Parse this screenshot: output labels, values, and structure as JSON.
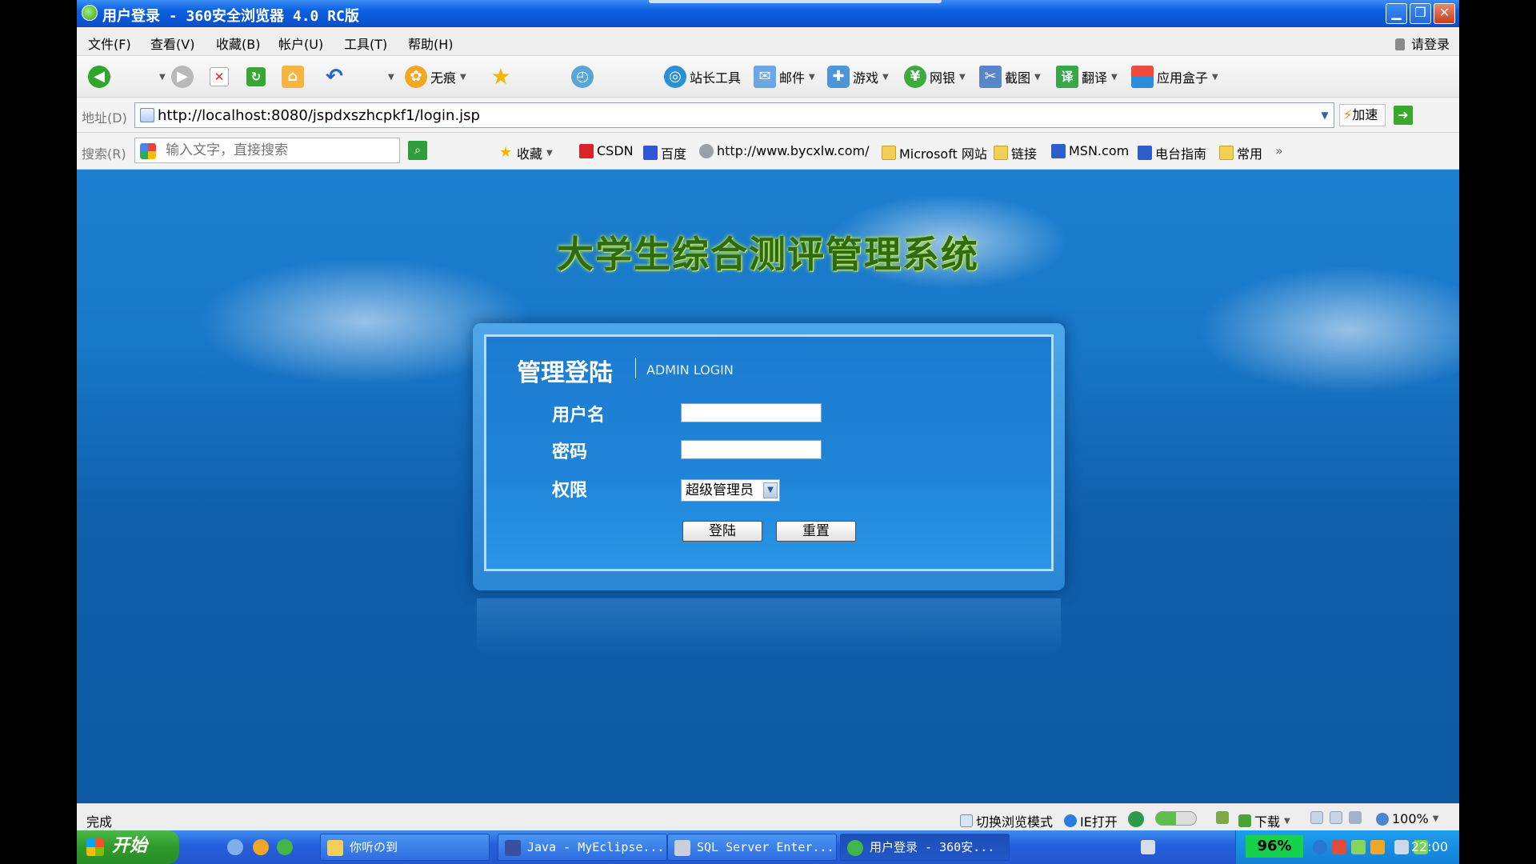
{
  "window": {
    "title": "用户登录 - 360安全浏览器 4.0 RC版"
  },
  "menu": {
    "items": [
      "文件(F)",
      "查看(V)",
      "收藏(B)",
      "帐户(U)",
      "工具(T)",
      "帮助(H)"
    ],
    "login": "请登录"
  },
  "toolbar": {
    "traceless": "无痕",
    "webmaster": "站长工具",
    "mail": "邮件",
    "games": "游戏",
    "netbank": "网银",
    "screenshot": "截图",
    "translate": "翻译",
    "appbox": "应用盒子"
  },
  "address": {
    "label": "地址(D)",
    "url": "http://localhost:8080/jspdxszhcpkf1/login.jsp",
    "speedup": "加速"
  },
  "search": {
    "label": "搜索(R)",
    "placeholder": "输入文字，直接搜索"
  },
  "bookmarks": {
    "favorites": "收藏",
    "csdn": "CSDN",
    "baidu": "百度",
    "bycxlw": "http://www.bycxlw.com/",
    "microsoft": "Microsoft 网站",
    "links": "链接",
    "msn": "MSN.com",
    "radio": "电台指南",
    "common": "常用",
    "more": "»"
  },
  "page": {
    "system_title": "大学生综合测评管理系统",
    "login": {
      "heading": "管理登陆",
      "subheading": "ADMIN LOGIN",
      "username_label": "用户名",
      "password_label": "密码",
      "role_label": "权限",
      "role_value": "超级管理员",
      "login_button": "登陆",
      "reset_button": "重置"
    }
  },
  "status": {
    "done": "完成",
    "switch_mode": "切换浏览模式",
    "ie_open": "IE打开",
    "download": "下载",
    "zoom": "100%"
  },
  "taskbar": {
    "start": "开始",
    "tasks": [
      "你听の到",
      "Java - MyEclipse...",
      "SQL Server Enter...",
      "用户登录 - 360安..."
    ],
    "battery": "96%",
    "clock": "22:00"
  }
}
